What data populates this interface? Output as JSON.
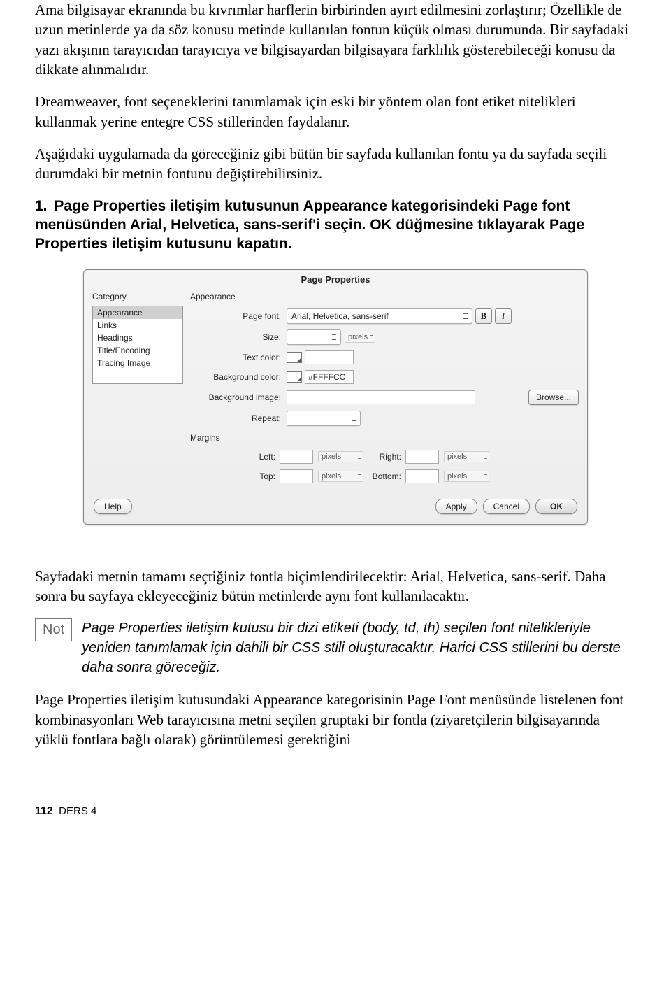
{
  "paragraphs": {
    "p1": "Ama bilgisayar ekranında bu kıvrımlar harflerin birbirinden ayırt edilmesini zorlaştırır; Özellikle de uzun metinlerde ya da söz konusu metinde kullanılan fontun küçük olması durumunda. Bir sayfadaki yazı akışının tarayıcıdan tarayıcıya ve bilgisayardan bilgisayara farklılık gösterebileceği konusu da dikkate alınmalıdır.",
    "p2": "Dreamweaver, font seçeneklerini tanımlamak için eski bir yöntem olan font etiket nitelikleri kullanmak yerine entegre CSS stillerinden faydalanır.",
    "p3": "Aşağıdaki uygulamada da göreceğiniz gibi bütün bir sayfada kullanılan fontu ya da sayfada seçili durumdaki bir metnin fontunu değiştirebilirsiniz.",
    "step1": "Page Properties iletişim kutusunun Appearance kategorisindeki Page font menüsünden Arial, Helvetica, sans-serif'i seçin. OK düğmesine tıklayarak Page Properties iletişim kutusunu kapatın.",
    "p4": "Sayfadaki metnin tamamı seçtiğiniz fontla biçimlendirilecektir: Arial, Helvetica, sans-serif. Daha sonra bu sayfaya ekleyeceğiniz bütün metinlerde aynı font kullanılacaktır.",
    "note": "Page Properties iletişim kutusu bir dizi etiketi (body, td, th) seçilen font nitelikleriyle yeniden tanımlamak için dahili bir CSS stili oluşturacaktır. Harici CSS stillerini bu derste daha sonra göreceğiz.",
    "p5": "Page Properties iletişim kutusundaki Appearance kategorisinin Page Font menüsünde listelenen font kombinasyonları Web tarayıcısına metni seçilen gruptaki bir fontla (ziyaretçilerin bilgisayarında yüklü fontlara bağlı olarak) görüntülemesi gerektiğini"
  },
  "labels": {
    "stepNum": "1.",
    "noteBadge": "Not"
  },
  "dialog": {
    "title": "Page Properties",
    "categoryLabel": "Category",
    "categories": [
      "Appearance",
      "Links",
      "Headings",
      "Title/Encoding",
      "Tracing Image"
    ],
    "appearanceLabel": "Appearance",
    "fields": {
      "pageFont": "Page font:",
      "pageFontValue": "Arial, Helvetica, sans-serif",
      "size": "Size:",
      "textColor": "Text color:",
      "bgColor": "Background color:",
      "bgColorValue": "#FFFFCC",
      "bgImage": "Background image:",
      "repeat": "Repeat:",
      "browse": "Browse...",
      "pixels": "pixels",
      "bold": "B",
      "italic": "I"
    },
    "marginsLabel": "Margins",
    "margins": {
      "left": "Left:",
      "right": "Right:",
      "top": "Top:",
      "bottom": "Bottom:"
    },
    "buttons": {
      "help": "Help",
      "apply": "Apply",
      "cancel": "Cancel",
      "ok": "OK"
    }
  },
  "footer": {
    "pageNum": "112",
    "lesson": "DERS 4"
  }
}
